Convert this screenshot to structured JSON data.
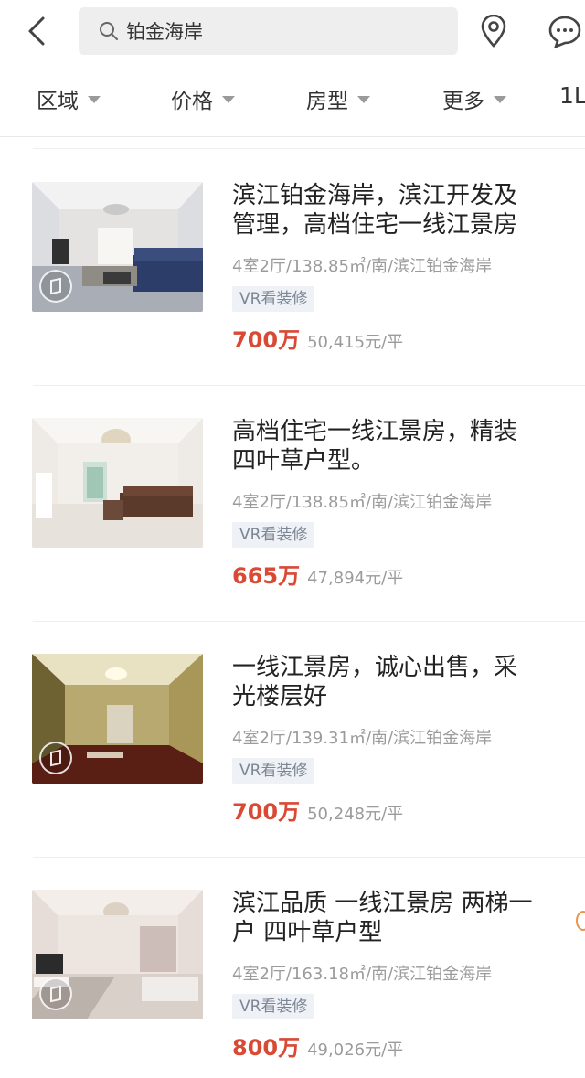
{
  "header": {
    "search_value": "铂金海岸",
    "icons": {
      "back": "chevron-left-icon",
      "search": "search-icon",
      "location": "location-pin-icon",
      "message": "chat-bubble-icon"
    }
  },
  "filters": {
    "items": [
      {
        "label": "区域"
      },
      {
        "label": "价格"
      },
      {
        "label": "房型"
      },
      {
        "label": "更多"
      }
    ],
    "sort_label": "1L"
  },
  "listings": [
    {
      "title_line1": "滨江铂金海岸，滨江开发及",
      "title_line2": "管理，高档住宅一线江景房",
      "meta": "4室2厅/138.85㎡/南/滨江铂金海岸",
      "tag": "VR看装修",
      "price": "700万",
      "unit_price": "50,415元/平"
    },
    {
      "title_line1": "高档住宅一线江景房，精装",
      "title_line2": "四叶草户型。",
      "meta": "4室2厅/138.85㎡/南/滨江铂金海岸",
      "tag": "VR看装修",
      "price": "665万",
      "unit_price": "47,894元/平"
    },
    {
      "title_line1": "一线江景房，诚心出售，采",
      "title_line2": "光楼层好",
      "meta": "4室2厅/139.31㎡/南/滨江铂金海岸",
      "tag": "VR看装修",
      "price": "700万",
      "unit_price": "50,248元/平"
    },
    {
      "title_line1": "滨江品质 一线江景房 两梯一",
      "title_line2": "户 四叶草户型",
      "meta": "4室2厅/163.18㎡/南/滨江铂金海岸",
      "tag": "VR看装修",
      "price": "800万",
      "unit_price": "49,026元/平"
    }
  ],
  "colors": {
    "price": "#d94a35",
    "tag_bg": "#eef1f5",
    "tag_text": "#7d8694",
    "meta": "#9b9b9b"
  }
}
